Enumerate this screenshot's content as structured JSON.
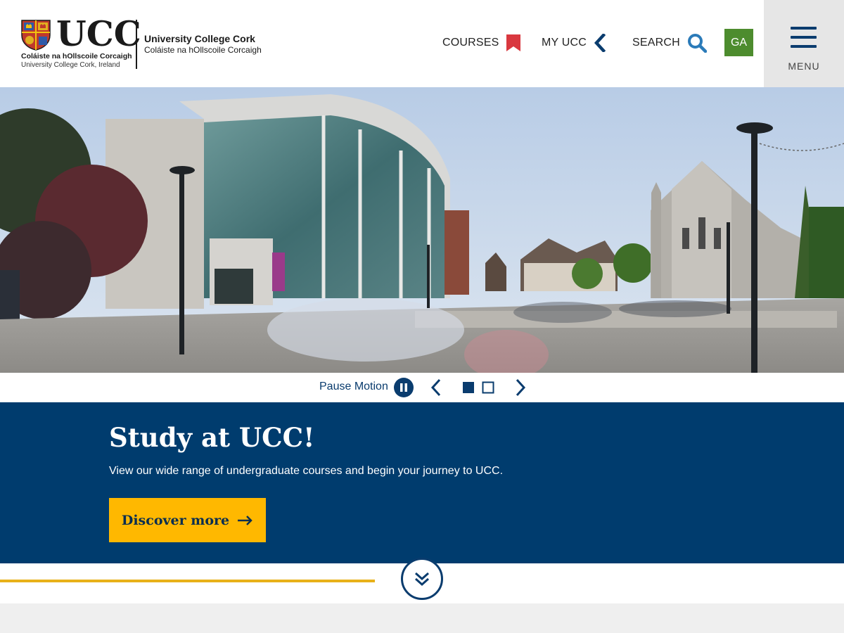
{
  "header": {
    "logo": {
      "wordmark": "UCC",
      "irish_name": "Coláiste na hOllscoile Corcaigh",
      "english_name": "University College Cork, Ireland"
    },
    "site_title": "University College Cork",
    "site_subtitle": "Coláiste na hOllscoile Corcaigh",
    "nav": [
      {
        "label": "COURSES",
        "icon": "bookmark-icon",
        "icon_color": "#d9383f"
      },
      {
        "label": "MY UCC",
        "icon": "chevron-left-icon",
        "icon_color": "#0a3c6e"
      },
      {
        "label": "SEARCH",
        "icon": "search-icon",
        "icon_color": "#2b7bb9"
      }
    ],
    "language_button": "GA",
    "menu_label": "MENU"
  },
  "slider": {
    "pause_label": "Pause Motion",
    "slide_count": 2,
    "active_slide": 1
  },
  "banner": {
    "title": "Study at UCC!",
    "text": "View our wide range of undergraduate courses and begin your journey to UCC.",
    "button_label": "Discover more"
  },
  "colors": {
    "brand_blue": "#003c6e",
    "accent_gold": "#ffb800",
    "lang_green": "#4d8c2e",
    "courses_red": "#d9383f"
  }
}
